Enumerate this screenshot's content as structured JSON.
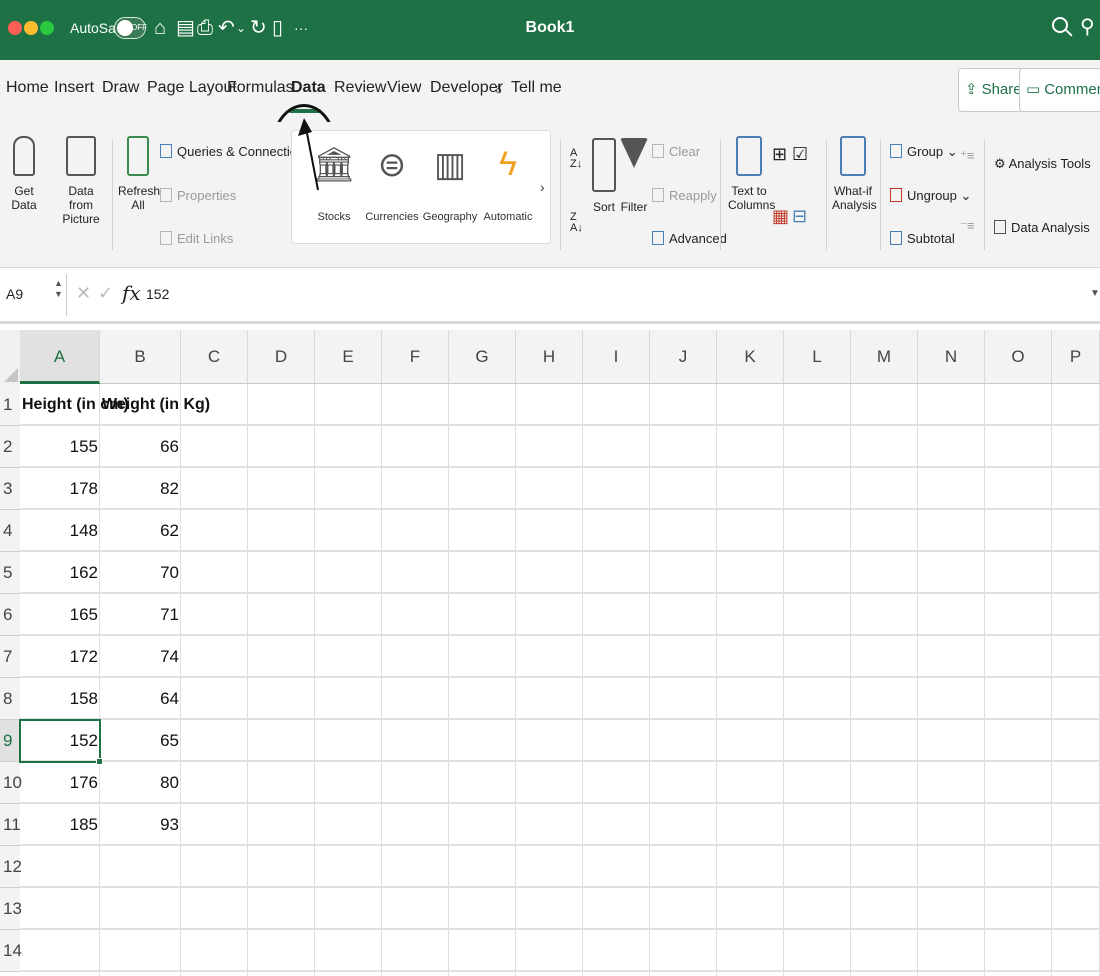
{
  "titlebar": {
    "autosave_label": "AutoSave",
    "autosave_state": "OFF",
    "more": "···",
    "doc_title": "Book1",
    "bg_color": "#1e7145"
  },
  "tabs": {
    "home": "Home",
    "insert": "Insert",
    "draw": "Draw",
    "page_layout": "Page Layout",
    "formulas": "Formulas",
    "data": "Data",
    "review": "Review",
    "view": "View",
    "developer": "Developer",
    "tell_me": "Tell me",
    "active": "Data"
  },
  "topbar": {
    "share": "Share",
    "comments": "Comments"
  },
  "ribbon": {
    "get_data_1": "Get",
    "get_data_2": "Data",
    "from_picture_1": "Data from",
    "from_picture_2": "Picture",
    "refresh_1": "Refresh",
    "refresh_2": "All",
    "queries": "Queries & Connections",
    "properties": "Properties",
    "edit_links": "Edit Links",
    "stocks": "Stocks",
    "currencies": "Currencies",
    "geography": "Geography",
    "automatic": "Automatic",
    "sort": "Sort",
    "filter": "Filter",
    "clear": "Clear",
    "reapply": "Reapply",
    "advanced": "Advanced",
    "text_to_1": "Text to",
    "text_to_2": "Columns",
    "whatif_1": "What-if",
    "whatif_2": "Analysis",
    "group": "Group",
    "ungroup": "Ungroup",
    "subtotal": "Subtotal",
    "analysis_tools": "Analysis Tools",
    "data_analysis": "Data Analysis"
  },
  "formula_bar": {
    "name_box": "A9",
    "fx": "fx",
    "value": "152"
  },
  "columns": [
    "A",
    "B",
    "C",
    "D",
    "E",
    "F",
    "G",
    "H",
    "I",
    "J",
    "K",
    "L",
    "M",
    "N",
    "O",
    "P"
  ],
  "rows": [
    "1",
    "2",
    "3",
    "4",
    "5",
    "6",
    "7",
    "8",
    "9",
    "10",
    "11",
    "12",
    "13",
    "14"
  ],
  "selected": {
    "column": "A",
    "row": "9"
  },
  "sheet": {
    "headers": [
      "Height (in cm)",
      "Weight (in Kg)"
    ],
    "data": [
      [
        "155",
        "66"
      ],
      [
        "178",
        "82"
      ],
      [
        "148",
        "62"
      ],
      [
        "162",
        "70"
      ],
      [
        "165",
        "71"
      ],
      [
        "172",
        "74"
      ],
      [
        "158",
        "64"
      ],
      [
        "152",
        "65"
      ],
      [
        "176",
        "80"
      ],
      [
        "185",
        "93"
      ]
    ]
  }
}
